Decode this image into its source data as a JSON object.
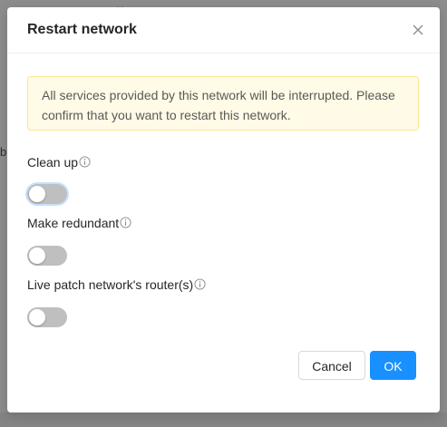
{
  "background": {
    "fragment_1": "b",
    "fragment_2": "",
    "fragment_3": "··"
  },
  "dialog": {
    "title": "Restart network",
    "close_icon": "close-icon",
    "alert_text": "All services provided by this network will be interrupted. Please confirm that you want to restart this network.",
    "fields": [
      {
        "label": "Clean up",
        "enabled": false,
        "icon": "info-icon"
      },
      {
        "label": "Make redundant",
        "enabled": false,
        "icon": "info-icon"
      },
      {
        "label": "Live patch network's router(s)",
        "enabled": false,
        "icon": "info-icon"
      }
    ],
    "cancel_label": "Cancel",
    "ok_label": "OK"
  },
  "colors": {
    "primary": "#1890ff",
    "alert_bg": "#fffbe6",
    "alert_border": "#ffe58f",
    "switch_off": "#bfbfbf"
  }
}
